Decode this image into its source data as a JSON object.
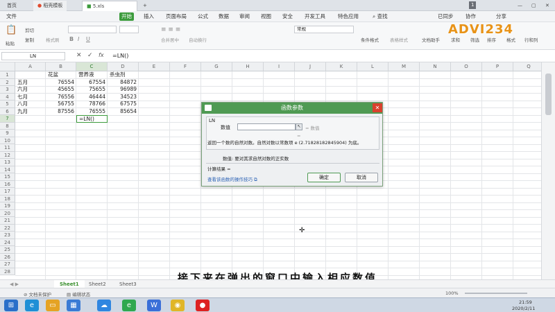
{
  "tabs": {
    "home": "首页",
    "template": "稻壳模板",
    "file": "5.xls"
  },
  "menu": {
    "file": "文件",
    "items": [
      "开始",
      "插入",
      "页面布局",
      "公式",
      "数据",
      "审阅",
      "视图",
      "安全",
      "开发工具",
      "特色应用"
    ],
    "search": "查找",
    "sync": "已同步",
    "collab": "协作",
    "share": "分享"
  },
  "ribbon": {
    "paste": "粘贴",
    "cut": "剪切",
    "copy": "复制",
    "format_painter": "格式刷",
    "merge_center": "合并居中",
    "wrap": "自动换行",
    "number_format": "常规",
    "conditional": "条件格式",
    "table_style": "表格样式",
    "doc_helper": "文档助手",
    "sum": "求和",
    "filter": "筛选",
    "sort": "排序",
    "format": "格式",
    "rows_cols": "行和列",
    "watermark": "ADVI234"
  },
  "formula_bar": {
    "name_box": "LN",
    "cancel": "✕",
    "confirm": "✓",
    "fx": "fx",
    "formula": "=LN()"
  },
  "grid": {
    "columns": [
      "A",
      "B",
      "C",
      "D",
      "E",
      "F",
      "G",
      "H",
      "I",
      "J",
      "K",
      "L",
      "M",
      "N",
      "O",
      "P",
      "Q"
    ],
    "rows": [
      "1",
      "2",
      "3",
      "4",
      "5",
      "6",
      "7",
      "8",
      "9",
      "10",
      "11",
      "12",
      "13",
      "14",
      "15",
      "16",
      "17",
      "18",
      "19",
      "20",
      "21",
      "22",
      "23",
      "24",
      "25",
      "26",
      "27",
      "28"
    ],
    "headers": [
      "花盆",
      "营养液",
      "杀虫剂"
    ],
    "data": [
      {
        "m": "五月",
        "b": "76554",
        "c": "67554",
        "d": "84872"
      },
      {
        "m": "六月",
        "b": "45655",
        "c": "75655",
        "d": "96989"
      },
      {
        "m": "七月",
        "b": "76556",
        "c": "46444",
        "d": "34523"
      },
      {
        "m": "八月",
        "b": "56755",
        "c": "78766",
        "d": "67575"
      },
      {
        "m": "九月",
        "b": "87556",
        "c": "76555",
        "d": "85654"
      }
    ],
    "active_cell": "=LN()"
  },
  "dialog": {
    "title": "函数参数",
    "func": "LN",
    "arg_label": "数值",
    "eq": "= 数值",
    "eq2": "=",
    "desc": "返回一个数的自然对数。自然对数以常数项 e (2.71828182845904) 为底。",
    "arg_desc": "数值: 要对其求自然对数的正实数",
    "result": "计算结果 =",
    "help_link": "查看该函数的操作技巧",
    "ok": "确定",
    "cancel": "取消"
  },
  "sheets": [
    "Sheet1",
    "Sheet2",
    "Sheet3"
  ],
  "status": {
    "protect": "文档未保护",
    "edit": "编辑状态",
    "zoom": "100%"
  },
  "taskbar": {
    "time": "21:59",
    "date": "2020/2/11"
  },
  "subtitle": "接下来在弹出的窗口中输入相应数值",
  "colors": {
    "accent": "#3c9b3c",
    "dialog_title": "#4f9a53"
  }
}
